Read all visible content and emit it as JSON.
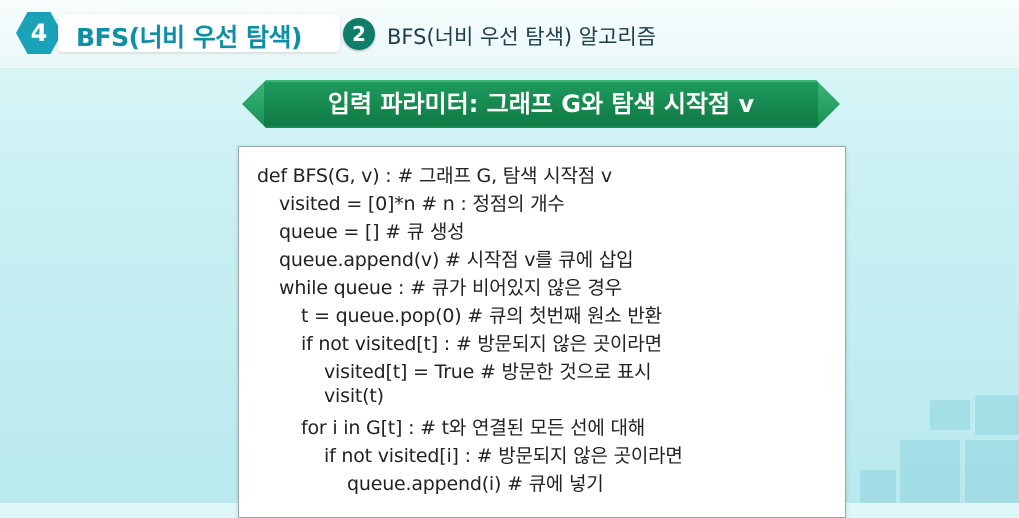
{
  "header": {
    "section_number": "4",
    "section_title": "BFS(너비 우선 탐색)",
    "sub_number": "2",
    "sub_title": "BFS(너비 우선 탐색) 알고리즘"
  },
  "banner": {
    "title": "입력 파라미터: 그래프 G와 탐색 시작점 v"
  },
  "code": {
    "lines": [
      "def BFS(G, v) : # 그래프 G, 탐색 시작점 v",
      "visited = [0]*n # n : 정점의 개수",
      "queue = [] # 큐 생성",
      "queue.append(v) # 시작점 v를 큐에 삽입",
      "while queue : # 큐가 비어있지 않은 경우",
      "t = queue.pop(0) # 큐의 첫번째 원소 반환",
      "if not visited[t] : # 방문되지 않은 곳이라면",
      "visited[t] = True # 방문한 것으로 표시",
      "visit(t)",
      "for i in G[t] : # t와 연결된 모든 선에 대해",
      "if not visited[i] : # 방문되지 않은 곳이라면",
      "queue.append(i) # 큐에 넣기"
    ]
  },
  "colors": {
    "accent_teal": "#1aa3b8",
    "banner_green": "#1a8f55",
    "sub_circle": "#0f7d69"
  }
}
